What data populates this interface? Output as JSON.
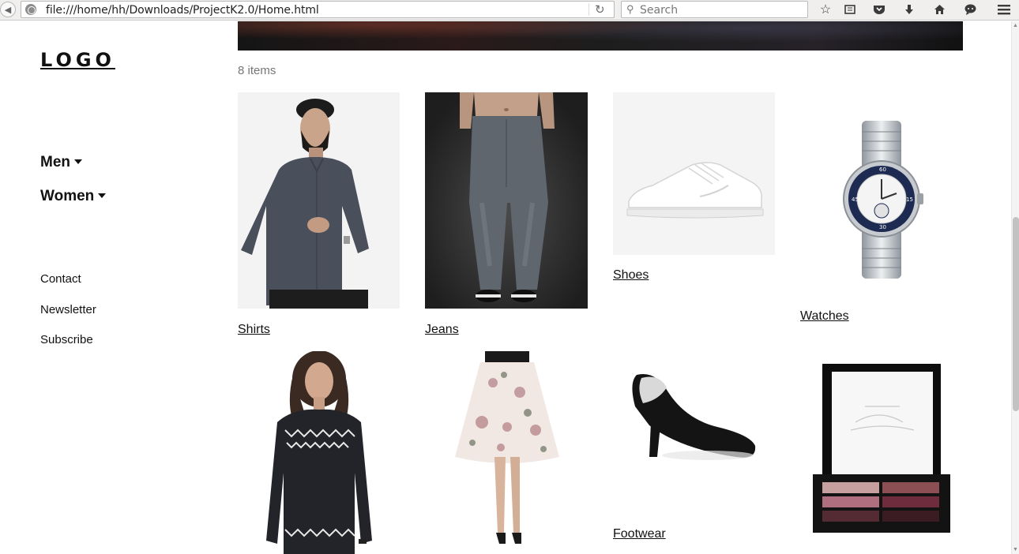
{
  "browser": {
    "url": "file:///home/hh/Downloads/ProjectK2.0/Home.html",
    "search_placeholder": "Search",
    "icons": [
      "back-icon",
      "globe-icon",
      "reload-icon",
      "search-icon",
      "star-icon",
      "reading-list-icon",
      "pocket-icon",
      "download-icon",
      "home-icon",
      "chat-icon",
      "menu-icon"
    ]
  },
  "sidebar": {
    "logo": "LOGO",
    "categories": [
      {
        "label": "Men"
      },
      {
        "label": "Women"
      }
    ],
    "links": [
      "Contact",
      "Newsletter",
      "Subscribe"
    ]
  },
  "main": {
    "item_count": "8 items",
    "products": [
      {
        "label": "Shirts",
        "image": "man-in-denim-shirt"
      },
      {
        "label": "Jeans",
        "image": "distressed-jeans"
      },
      {
        "label": "Shoes",
        "image": "white-sneaker"
      },
      {
        "label": "Watches",
        "image": "steel-wristwatch"
      },
      {
        "label": "",
        "image": "woman-in-embroidered-top"
      },
      {
        "label": "",
        "image": "floral-skirt"
      },
      {
        "label": "Footwear",
        "image": "black-heel-pump"
      },
      {
        "label": "",
        "image": "eyeshadow-palette"
      }
    ]
  },
  "colors": {
    "text": "#111111",
    "muted": "#777777",
    "toolbar": "#f0efee"
  }
}
